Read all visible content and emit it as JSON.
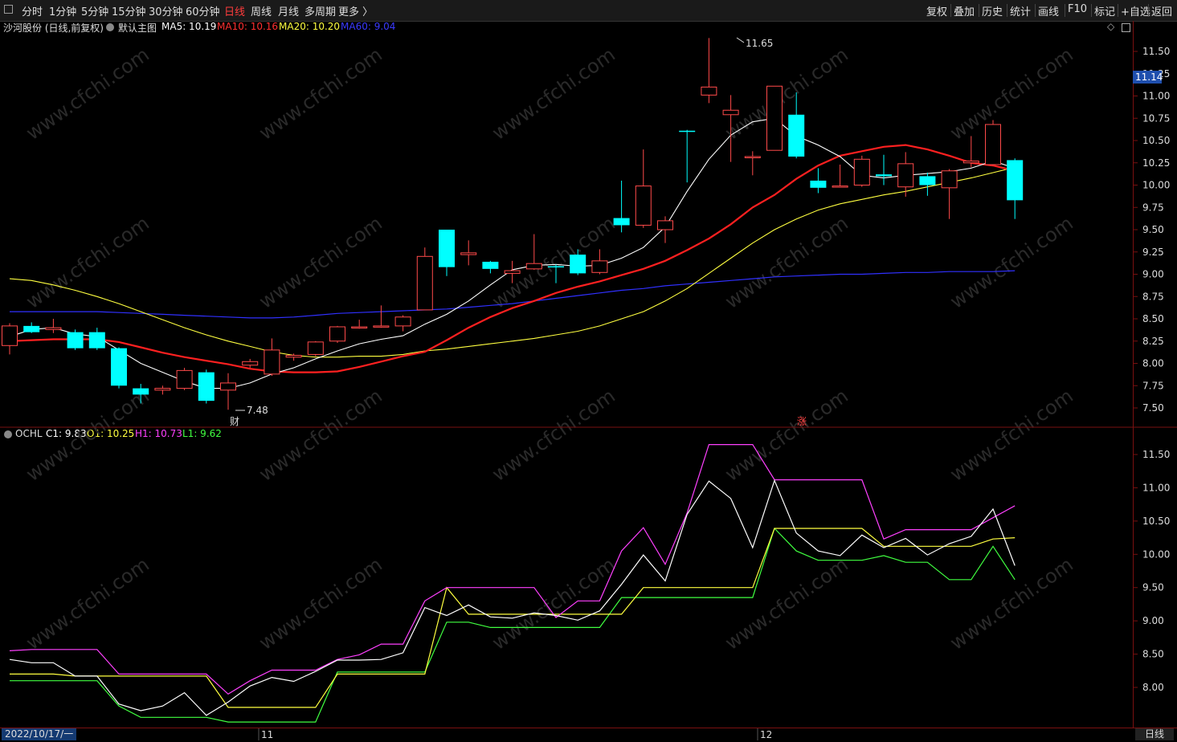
{
  "toolbar": {
    "window_icon": "window-restore-icon",
    "periods": [
      "分时",
      "1分钟",
      "5分钟",
      "15分钟",
      "30分钟",
      "60分钟",
      "日线",
      "周线",
      "月线",
      "多周期",
      "更多 〉"
    ],
    "active_period": "日线",
    "tools": [
      "复权",
      "叠加",
      "历史",
      "统计",
      "画线",
      "F10",
      "标记",
      "+自选",
      "返回"
    ]
  },
  "main_info": {
    "stock": "沙河股份 (日线,前复权)",
    "template": "默认主图",
    "ma5": "MA5: 10.19",
    "ma10": "MA10: 10.16",
    "ma20": "MA20: 10.20",
    "ma60": "MA60: 9.04",
    "colors": {
      "ma5": "#ffffff",
      "ma10": "#ff2020",
      "ma20": "#ffff40",
      "ma60": "#3030ff"
    }
  },
  "sub_info": {
    "name": "OCHL",
    "c1": "C1: 9.83",
    "o1": "O1: 10.25",
    "h1": "H1: 10.73",
    "l1": "L1: 9.62",
    "colors": {
      "c1": "#ffffff",
      "o1": "#ffff40",
      "h1": "#ff40ff",
      "l1": "#40ff40"
    }
  },
  "price_tag": "11.14",
  "annotations": {
    "high": "11.65",
    "low": "7.48",
    "cai": "财",
    "zhang": "涨"
  },
  "bottom": {
    "date": "2022/10/17/一",
    "month_11": "11",
    "month_12": "12",
    "period": "日线"
  },
  "watermark": "www.cfchi.com",
  "chart_data": [
    {
      "type": "candlestick",
      "title": "沙河股份 (日线,前复权)",
      "yaxis_ticks": [
        "11.50",
        "11.25",
        "11.00",
        "10.75",
        "10.50",
        "10.25",
        "10.00",
        "9.75",
        "9.50",
        "9.25",
        "9.00",
        "8.75",
        "8.50",
        "8.25",
        "8.00",
        "7.75",
        "7.50"
      ],
      "ylim": [
        7.4,
        11.8
      ],
      "candles": [
        {
          "o": 8.2,
          "h": 8.45,
          "l": 8.1,
          "c": 8.42
        },
        {
          "o": 8.42,
          "h": 8.46,
          "l": 8.34,
          "c": 8.35
        },
        {
          "o": 8.38,
          "h": 8.5,
          "l": 8.34,
          "c": 8.4
        },
        {
          "o": 8.35,
          "h": 8.38,
          "l": 8.15,
          "c": 8.17
        },
        {
          "o": 8.35,
          "h": 8.4,
          "l": 8.15,
          "c": 8.17
        },
        {
          "o": 8.17,
          "h": 8.18,
          "l": 7.72,
          "c": 7.75
        },
        {
          "o": 7.72,
          "h": 7.77,
          "l": 7.55,
          "c": 7.65
        },
        {
          "o": 7.7,
          "h": 7.75,
          "l": 7.65,
          "c": 7.72
        },
        {
          "o": 7.72,
          "h": 7.95,
          "l": 7.7,
          "c": 7.92
        },
        {
          "o": 7.9,
          "h": 7.93,
          "l": 7.55,
          "c": 7.58
        },
        {
          "o": 7.7,
          "h": 7.89,
          "l": 7.48,
          "c": 7.78
        },
        {
          "o": 7.98,
          "h": 8.05,
          "l": 7.95,
          "c": 8.02
        },
        {
          "o": 7.88,
          "h": 8.28,
          "l": 7.86,
          "c": 8.15
        },
        {
          "o": 8.07,
          "h": 8.11,
          "l": 8.03,
          "c": 8.09
        },
        {
          "o": 8.1,
          "h": 8.25,
          "l": 8.08,
          "c": 8.24
        },
        {
          "o": 8.25,
          "h": 8.42,
          "l": 8.23,
          "c": 8.41
        },
        {
          "o": 8.41,
          "h": 8.49,
          "l": 8.39,
          "c": 8.41
        },
        {
          "o": 8.42,
          "h": 8.65,
          "l": 8.4,
          "c": 8.42
        },
        {
          "o": 8.42,
          "h": 8.54,
          "l": 8.36,
          "c": 8.52
        },
        {
          "o": 8.6,
          "h": 9.3,
          "l": 8.6,
          "c": 9.2
        },
        {
          "o": 9.5,
          "h": 9.5,
          "l": 8.98,
          "c": 9.08
        },
        {
          "o": 9.22,
          "h": 9.38,
          "l": 9.1,
          "c": 9.24
        },
        {
          "o": 9.14,
          "h": 9.15,
          "l": 9.01,
          "c": 9.06
        },
        {
          "o": 9.01,
          "h": 9.15,
          "l": 8.9,
          "c": 9.04
        },
        {
          "o": 9.06,
          "h": 9.45,
          "l": 9.05,
          "c": 9.12
        },
        {
          "o": 9.09,
          "h": 9.11,
          "l": 8.9,
          "c": 9.08
        },
        {
          "o": 9.22,
          "h": 9.28,
          "l": 8.99,
          "c": 9.01
        },
        {
          "o": 9.02,
          "h": 9.28,
          "l": 9.0,
          "c": 9.15
        },
        {
          "o": 9.63,
          "h": 10.05,
          "l": 9.47,
          "c": 9.55
        },
        {
          "o": 9.55,
          "h": 10.4,
          "l": 9.52,
          "c": 9.99
        },
        {
          "o": 9.5,
          "h": 9.65,
          "l": 9.35,
          "c": 9.6
        },
        {
          "o": 10.61,
          "h": 10.62,
          "l": 10.03,
          "c": 10.6
        },
        {
          "o": 11.01,
          "h": 11.65,
          "l": 10.92,
          "c": 11.1
        },
        {
          "o": 10.79,
          "h": 11.01,
          "l": 10.26,
          "c": 10.84
        },
        {
          "o": 10.32,
          "h": 10.38,
          "l": 10.11,
          "c": 10.32
        },
        {
          "o": 10.39,
          "h": 11.11,
          "l": 10.39,
          "c": 11.11
        },
        {
          "o": 10.79,
          "h": 11.04,
          "l": 10.3,
          "c": 10.32
        },
        {
          "o": 10.05,
          "h": 10.19,
          "l": 9.91,
          "c": 9.97
        },
        {
          "o": 9.99,
          "h": 10.23,
          "l": 9.98,
          "c": 9.99
        },
        {
          "o": 10.0,
          "h": 10.33,
          "l": 9.98,
          "c": 10.29
        },
        {
          "o": 10.12,
          "h": 10.34,
          "l": 10.0,
          "c": 10.1
        },
        {
          "o": 9.98,
          "h": 10.37,
          "l": 9.87,
          "c": 10.24
        },
        {
          "o": 10.1,
          "h": 10.14,
          "l": 9.88,
          "c": 10.0
        },
        {
          "o": 9.97,
          "h": 10.18,
          "l": 9.62,
          "c": 10.16
        },
        {
          "o": 10.25,
          "h": 10.55,
          "l": 10.2,
          "c": 10.27
        },
        {
          "o": 10.23,
          "h": 10.73,
          "l": 10.22,
          "c": 10.68
        },
        {
          "o": 10.28,
          "h": 10.3,
          "l": 9.62,
          "c": 9.83
        }
      ],
      "ma5": [
        8.3,
        8.38,
        8.4,
        8.33,
        8.3,
        8.15,
        8.0,
        7.9,
        7.8,
        7.72,
        7.72,
        7.78,
        7.88,
        7.95,
        8.05,
        8.14,
        8.22,
        8.27,
        8.31,
        8.44,
        8.55,
        8.7,
        8.88,
        9.05,
        9.1,
        9.11,
        9.09,
        9.1,
        9.18,
        9.3,
        9.53,
        9.93,
        10.29,
        10.56,
        10.71,
        10.75,
        10.55,
        10.45,
        10.32,
        10.11,
        10.08,
        10.11,
        10.13,
        10.15,
        10.19,
        10.27,
        10.19
      ],
      "ma10": [
        8.25,
        8.26,
        8.27,
        8.27,
        8.27,
        8.24,
        8.18,
        8.12,
        8.07,
        8.03,
        7.99,
        7.94,
        7.91,
        7.9,
        7.9,
        7.91,
        7.96,
        8.02,
        8.08,
        8.13,
        8.26,
        8.4,
        8.52,
        8.62,
        8.7,
        8.79,
        8.86,
        8.92,
        8.99,
        9.06,
        9.15,
        9.27,
        9.4,
        9.56,
        9.75,
        9.89,
        10.07,
        10.22,
        10.33,
        10.38,
        10.43,
        10.45,
        10.4,
        10.33,
        10.25,
        10.22,
        10.16
      ],
      "ma20": [
        8.95,
        8.93,
        8.88,
        8.82,
        8.75,
        8.67,
        8.58,
        8.49,
        8.4,
        8.32,
        8.25,
        8.19,
        8.13,
        8.09,
        8.07,
        8.07,
        8.08,
        8.08,
        8.1,
        8.14,
        8.16,
        8.19,
        8.22,
        8.25,
        8.28,
        8.32,
        8.36,
        8.42,
        8.5,
        8.58,
        8.7,
        8.84,
        9.01,
        9.18,
        9.35,
        9.5,
        9.62,
        9.72,
        9.79,
        9.84,
        9.89,
        9.93,
        9.98,
        10.03,
        10.08,
        10.14,
        10.2
      ],
      "ma60": [
        8.58,
        8.58,
        8.58,
        8.58,
        8.58,
        8.57,
        8.56,
        8.55,
        8.54,
        8.53,
        8.52,
        8.51,
        8.51,
        8.52,
        8.54,
        8.56,
        8.57,
        8.58,
        8.59,
        8.6,
        8.61,
        8.63,
        8.65,
        8.67,
        8.7,
        8.73,
        8.76,
        8.79,
        8.82,
        8.84,
        8.87,
        8.89,
        8.91,
        8.93,
        8.95,
        8.97,
        8.98,
        8.99,
        9.0,
        9.0,
        9.01,
        9.02,
        9.02,
        9.03,
        9.03,
        9.03,
        9.04
      ]
    },
    {
      "type": "line",
      "title": "OCHL",
      "yaxis_ticks": [
        "11.50",
        "11.00",
        "10.50",
        "10.00",
        "9.50",
        "9.00",
        "8.50",
        "8.00"
      ],
      "ylim": [
        7.4,
        11.8
      ],
      "series": [
        {
          "name": "C1",
          "values": [
            8.42,
            8.37,
            8.37,
            8.17,
            8.17,
            7.75,
            7.65,
            7.72,
            7.92,
            7.58,
            7.78,
            8.02,
            8.15,
            8.09,
            8.24,
            8.41,
            8.41,
            8.42,
            8.52,
            9.2,
            9.08,
            9.24,
            9.06,
            9.04,
            9.12,
            9.08,
            9.01,
            9.15,
            9.55,
            9.99,
            9.6,
            10.6,
            11.1,
            10.84,
            10.1,
            11.11,
            10.32,
            10.05,
            9.98,
            10.29,
            10.1,
            10.24,
            9.99,
            10.16,
            10.27,
            10.68,
            9.83
          ]
        },
        {
          "name": "O1",
          "values": [
            8.2,
            8.2,
            8.2,
            8.17,
            8.17,
            8.17,
            8.17,
            8.17,
            8.17,
            8.17,
            7.7,
            7.7,
            7.7,
            7.7,
            7.7,
            8.2,
            8.2,
            8.2,
            8.2,
            8.2,
            9.5,
            9.1,
            9.1,
            9.1,
            9.1,
            9.1,
            9.1,
            9.1,
            9.1,
            9.5,
            9.5,
            9.5,
            9.5,
            9.5,
            9.5,
            10.39,
            10.39,
            10.39,
            10.39,
            10.39,
            10.12,
            10.12,
            10.12,
            10.12,
            10.12,
            10.23,
            10.25
          ]
        },
        {
          "name": "H1",
          "values": [
            8.55,
            8.57,
            8.57,
            8.57,
            8.57,
            8.2,
            8.2,
            8.2,
            8.2,
            8.2,
            7.9,
            8.1,
            8.26,
            8.26,
            8.26,
            8.42,
            8.49,
            8.65,
            8.65,
            9.3,
            9.5,
            9.5,
            9.5,
            9.5,
            9.5,
            9.05,
            9.3,
            9.3,
            10.05,
            10.4,
            9.85,
            10.62,
            11.65,
            11.65,
            11.65,
            11.12,
            11.12,
            11.12,
            11.12,
            11.12,
            10.23,
            10.37,
            10.37,
            10.37,
            10.37,
            10.55,
            10.73
          ]
        },
        {
          "name": "L1",
          "values": [
            8.1,
            8.1,
            8.1,
            8.1,
            8.1,
            7.72,
            7.55,
            7.55,
            7.55,
            7.55,
            7.48,
            7.48,
            7.48,
            7.48,
            7.48,
            8.23,
            8.23,
            8.23,
            8.23,
            8.23,
            8.98,
            8.98,
            8.9,
            8.9,
            8.9,
            8.9,
            8.9,
            8.9,
            9.35,
            9.35,
            9.35,
            9.35,
            9.35,
            9.35,
            9.35,
            10.39,
            10.05,
            9.91,
            9.91,
            9.91,
            9.98,
            9.88,
            9.88,
            9.62,
            9.62,
            10.12,
            9.62
          ]
        }
      ]
    }
  ]
}
